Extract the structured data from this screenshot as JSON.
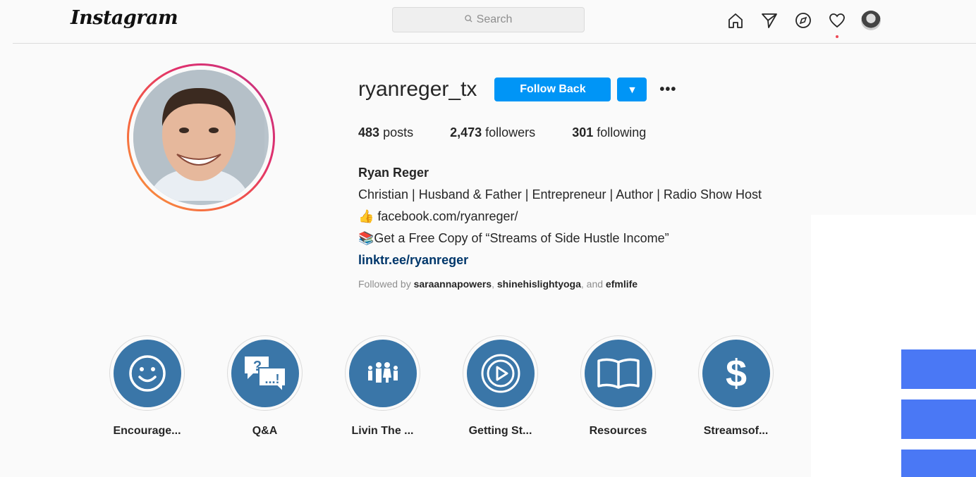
{
  "header": {
    "logo": "Instagram",
    "search_placeholder": "Search",
    "icons": [
      "home-icon",
      "direct-icon",
      "explore-icon",
      "heart-icon",
      "avatar"
    ]
  },
  "profile": {
    "username": "ryanreger_tx",
    "follow_label": "Follow Back",
    "dropdown_glyph": "▼",
    "more_glyph": "•••",
    "stats": {
      "posts_count": "483",
      "posts_label": "posts",
      "followers_count": "2,473",
      "followers_label": "followers",
      "following_count": "301",
      "following_label": "following"
    },
    "bio": {
      "name": "Ryan Reger",
      "line1": "Christian | Husband & Father | Entrepreneur | Author | Radio Show Host",
      "line2": "👍 facebook.com/ryanreger/",
      "line3": "📚Get a Free Copy of “Streams of Side Hustle Income”",
      "link": "linktr.ee/ryanreger"
    },
    "followed_by": {
      "prefix": "Followed by",
      "user1": "saraannapowers",
      "user2": "shinehislightyoga",
      "conj": "and",
      "user3": "efmlife"
    }
  },
  "highlights": [
    {
      "label": "Encourage...",
      "icon": "smiley-icon"
    },
    {
      "label": "Q&A",
      "icon": "speech-bubbles-icon"
    },
    {
      "label": "Livin The ...",
      "icon": "family-icon"
    },
    {
      "label": "Getting St...",
      "icon": "play-icon"
    },
    {
      "label": "Resources",
      "icon": "book-icon"
    },
    {
      "label": "Streamsof...",
      "icon": "dollar-icon"
    }
  ],
  "colors": {
    "accent": "#0095f6",
    "link": "#00376b",
    "highlight_fill": "#3a76a8",
    "overlay_bar": "#4a78f5"
  }
}
